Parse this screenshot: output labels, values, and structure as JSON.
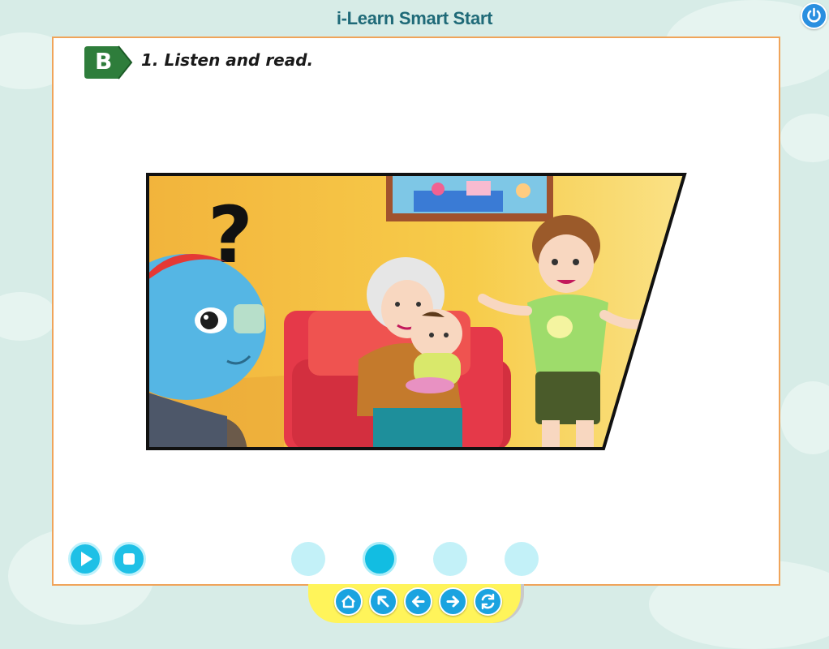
{
  "app": {
    "title": "i-Learn Smart Start"
  },
  "section": {
    "badge": "B",
    "instruction": "1. Listen and read."
  },
  "colors": {
    "background": "#d7ece7",
    "panel_border": "#f0a45a",
    "badge_green": "#2e7d3b",
    "accent_cyan": "#1ec0e6",
    "nav_blue": "#1aa3e0",
    "bottom_bar_yellow": "#fff45a"
  },
  "controls": {
    "play_icon": "play-icon",
    "stop_icon": "stop-icon"
  },
  "pagination": {
    "total": 4,
    "current": 2
  },
  "nav": {
    "icons": [
      "home-icon",
      "back-arrow-icon",
      "left-arrow-icon",
      "right-arrow-icon",
      "refresh-icon"
    ]
  },
  "power_icon": "power-icon"
}
